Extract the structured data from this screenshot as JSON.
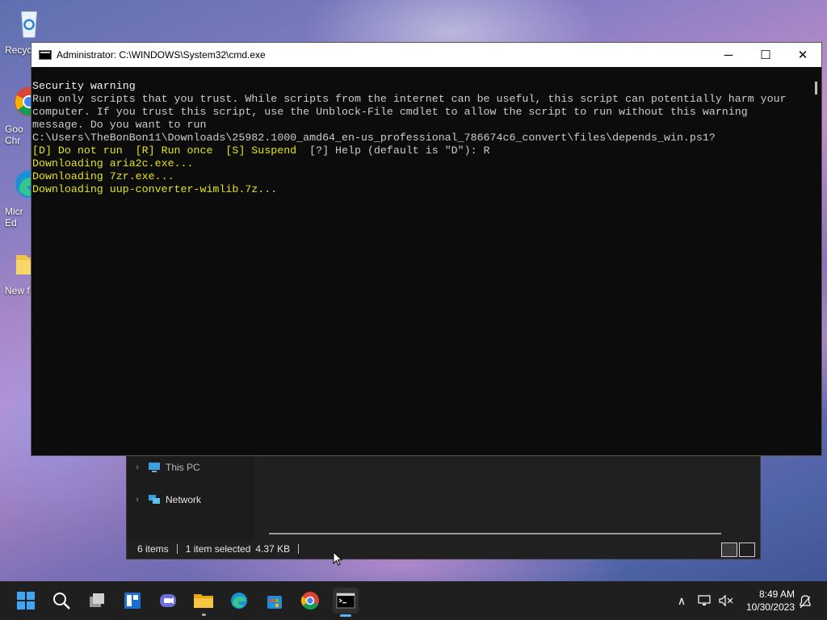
{
  "desktop": {
    "icons": [
      {
        "label": "Recyc",
        "icon": "recycle-bin-icon"
      },
      {
        "label": "Goo\nChr",
        "icon": "chrome-icon"
      },
      {
        "label": "Micr\nEd",
        "icon": "edge-icon"
      },
      {
        "label": "New f",
        "icon": "folder-icon"
      }
    ]
  },
  "cmd": {
    "title": "Administrator: C:\\WINDOWS\\System32\\cmd.exe",
    "controls": {
      "minimize": "─",
      "maximize": "☐",
      "close": "✕"
    },
    "lines": [
      {
        "text": "Security warning",
        "color": "white"
      },
      {
        "text": "Run only scripts that you trust. While scripts from the internet can be useful, this script can potentially harm your",
        "color": "gray"
      },
      {
        "text": "computer. If you trust this script, use the Unblock-File cmdlet to allow the script to run without this warning",
        "color": "gray"
      },
      {
        "text": "message. Do you want to run",
        "color": "gray"
      },
      {
        "text": "C:\\Users\\TheBonBon11\\Downloads\\25982.1000_amd64_en-us_professional_786674c6_convert\\files\\depends_win.ps1?",
        "color": "gray"
      },
      {
        "text": "[D] Do not run  [R] Run once  [S] Suspend  [?] Help (default is \"D\"): R",
        "color": "mixed"
      },
      {
        "text": "Downloading aria2c.exe...",
        "color": "yellow"
      },
      {
        "text": "Downloading 7zr.exe...",
        "color": "yellow"
      },
      {
        "text": "Downloading uup-converter-wimlib.7z...",
        "color": "yellow"
      }
    ],
    "prompt_parts": {
      "options": "[D] Do not run  [R] Run once  [S] Suspend  ",
      "help": "[?] Help (default is \"D\"): R"
    }
  },
  "explorer": {
    "nav_items": [
      {
        "label": "This PC",
        "icon": "this-pc-icon"
      },
      {
        "label": "Network",
        "icon": "network-icon"
      }
    ],
    "status": {
      "items_count": "6 items",
      "selected": "1 item selected",
      "size": "4.37 KB"
    }
  },
  "taskbar": {
    "apps": [
      "start-icon",
      "search-icon",
      "task-view-icon",
      "widgets-icon",
      "teams-chat-icon",
      "file-explorer-icon",
      "edge-icon",
      "store-icon",
      "chrome-icon",
      "terminal-icon"
    ],
    "tray_chevron": "∧",
    "time": "8:49 AM",
    "date": "10/30/2023"
  },
  "colors": {
    "console_bg": "#0c0c0c",
    "console_text": "#cccccc",
    "console_yellow": "#e5e510",
    "taskbar_bg": "#1f1f1f",
    "accent": "#5bb8ff"
  }
}
